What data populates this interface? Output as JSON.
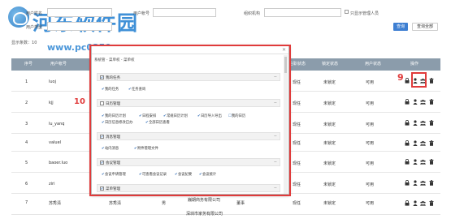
{
  "watermark": {
    "title": "河东软件园",
    "url": "www.pc0359.cn"
  },
  "filters": {
    "user_name_label": "用户姓名",
    "user_account_label": "用户帐号",
    "org_label": "组织机构",
    "show_admin_label": "只显示管理人员",
    "user_type_label": "用户类型",
    "query_button": "查询",
    "query_all_button": "查询全部",
    "page_size_label": "显示条数：",
    "page_size_value": "10"
  },
  "table": {
    "headers": [
      "序号",
      "用户帐号",
      "在职状态",
      "锁定状态",
      "用户状态",
      "操作"
    ],
    "rows": [
      {
        "no": "1",
        "account": "luoj",
        "name": "",
        "gender": "",
        "position": "",
        "employment": "现任",
        "lock": "未锁定",
        "status": "可用"
      },
      {
        "no": "2",
        "account": "kjj",
        "name": "",
        "gender": "",
        "position": "",
        "employment": "现任",
        "lock": "未锁定",
        "status": "可用"
      },
      {
        "no": "3",
        "account": "lu_yanq",
        "name": "",
        "gender": "",
        "position": "",
        "employment": "现任",
        "lock": "未锁定",
        "status": "可用"
      },
      {
        "no": "4",
        "account": "valuel",
        "name": "",
        "gender": "",
        "position": "",
        "employment": "现任",
        "lock": "未锁定",
        "status": "可用"
      },
      {
        "no": "5",
        "account": "baoer.luo",
        "name": "",
        "gender": "",
        "position": "",
        "employment": "现任",
        "lock": "未锁定",
        "status": "可用"
      },
      {
        "no": "6",
        "account": "ziri",
        "name": "",
        "gender": "",
        "position": "",
        "employment": "现任",
        "lock": "未锁定",
        "status": "可用"
      },
      {
        "no": "7",
        "account": "苏秀清",
        "name": "苏秀清",
        "gender": "男",
        "position": "董事",
        "employment": "现任",
        "lock": "未锁定",
        "status": "可用"
      }
    ],
    "row7_org": "巍期商务有限公司",
    "row8_org": "深圳市家务有限公司"
  },
  "annotations": {
    "ops_label": "9",
    "modal_label": "10"
  },
  "modal": {
    "breadcrumb": "系统管 - 菜单权 - 菜单权",
    "sections": [
      {
        "title": "我的任务",
        "items": [
          "我的任务",
          "任务查询"
        ]
      },
      {
        "title": "日历管理",
        "items": [
          "我的日历计划",
          "日程安排",
          "常规日历计划",
          "日历导入导出",
          "我的日历",
          "日历信息修改已办",
          "全部日历查看"
        ]
      },
      {
        "title": "消息管理",
        "items": [
          "站内消息",
          "附件管理文件"
        ]
      },
      {
        "title": "会议管理",
        "items": [
          "会议申请管理",
          "可查看会议记录",
          "会议纪要",
          "会议统计"
        ]
      },
      {
        "title": "菜单管理",
        "items": []
      }
    ]
  },
  "colors": {
    "header_bg": "#8b9cab",
    "primary": "#3e7fd2",
    "annotation_red": "#e03b3b",
    "watermark_blue": "#2b84d3"
  }
}
